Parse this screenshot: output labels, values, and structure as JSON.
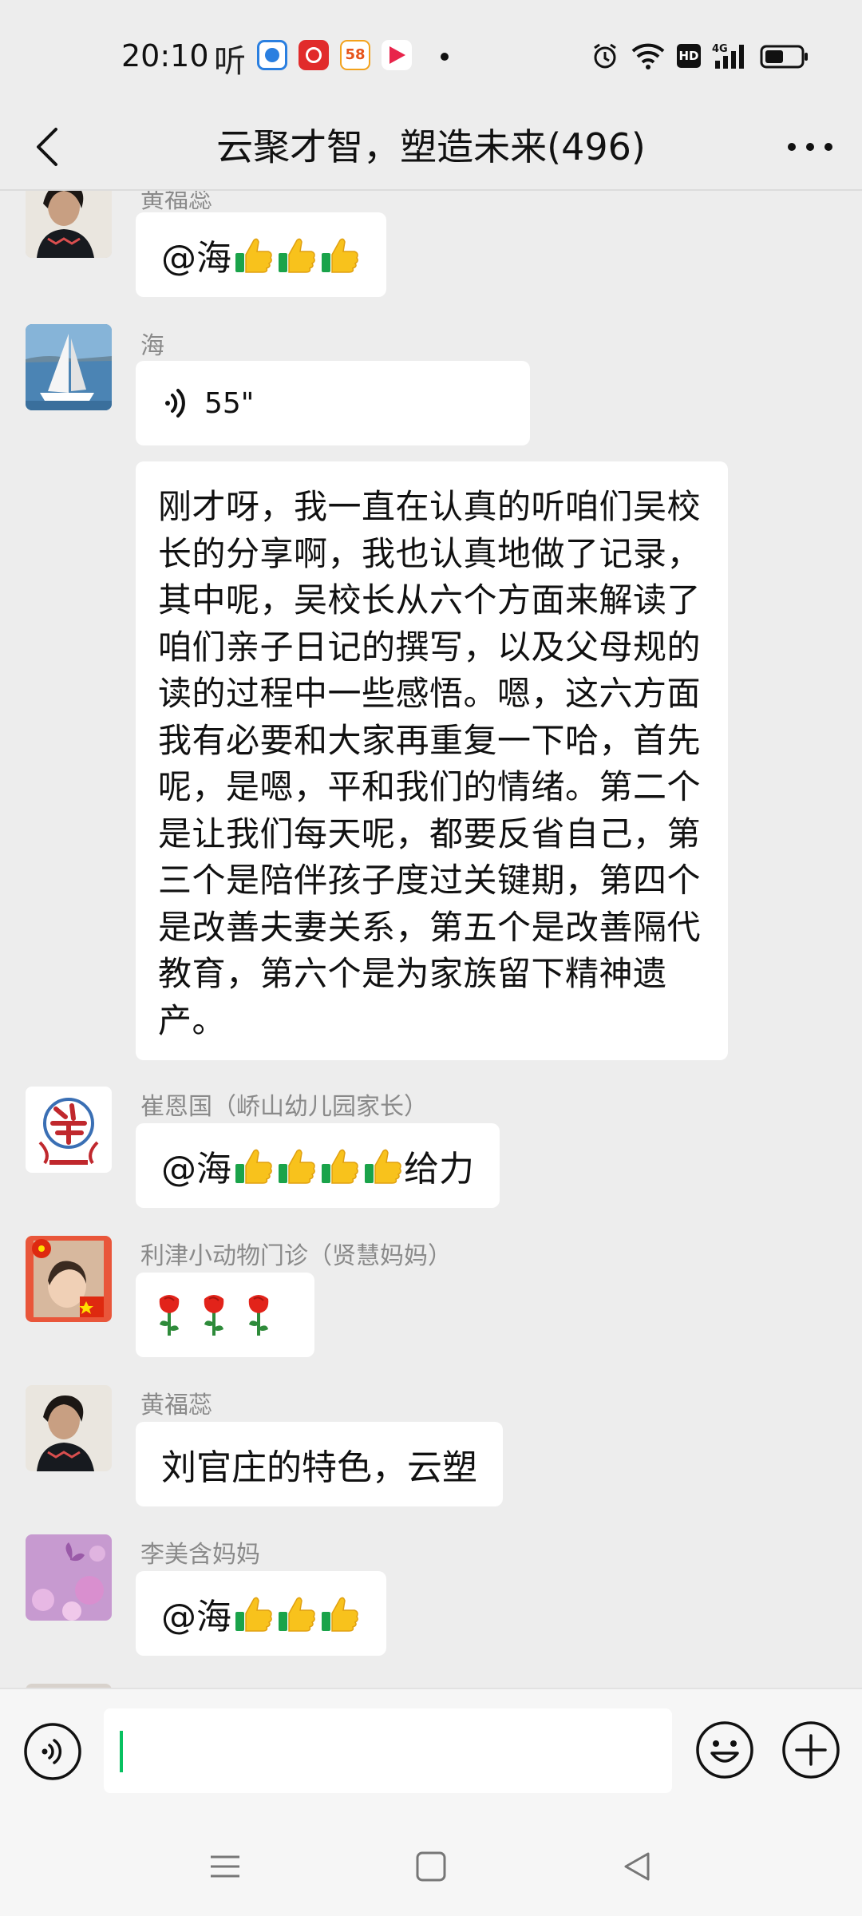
{
  "status_bar": {
    "time": "20:10",
    "ting_glyph": "听",
    "app_58": "58",
    "icons": [
      "alarm-icon",
      "wifi-icon",
      "hd-badge",
      "signal-4g-icon",
      "battery-icon"
    ],
    "hd_label": "HD",
    "network_label": "4G"
  },
  "header": {
    "title": "云聚才智，塑造未来(496)"
  },
  "messages": [
    {
      "sender": "黄福蕊",
      "content": "@海",
      "thumbs": 3
    },
    {
      "sender": "海",
      "voice_duration": "55\""
    },
    {
      "sender": "海",
      "content": "刚才呀，我一直在认真的听咱们吴校长的分享啊，我也认真地做了记录，其中呢，吴校长从六个方面来解读了咱们亲子日记的撰写，以及父母规的读的过程中一些感悟。嗯，这六方面我有必要和大家再重复一下哈，首先呢，是嗯，平和我们的情绪。第二个是让我们每天呢，都要反省自己，第三个是陪伴孩子度过关键期，第四个是改善夫妻关系，第五个是改善隔代教育，第六个是为家族留下精神遗产。"
    },
    {
      "sender": "崔恩国（峤山幼儿园家长）",
      "content": "@海",
      "thumbs": 4,
      "suffix": "给力"
    },
    {
      "sender": "利津小动物门诊（贤慧妈妈）",
      "roses": 3
    },
    {
      "sender": "黄福蕊",
      "content": "刘官庄的特色，云塑"
    },
    {
      "sender": "李美含妈妈",
      "content": "@海",
      "thumbs": 3
    }
  ],
  "input": {
    "value": "",
    "placeholder": ""
  },
  "colors": {
    "background": "#ededed",
    "bubble": "#ffffff",
    "accent_green": "#07c160",
    "sender_gray": "#8a8a8a"
  }
}
